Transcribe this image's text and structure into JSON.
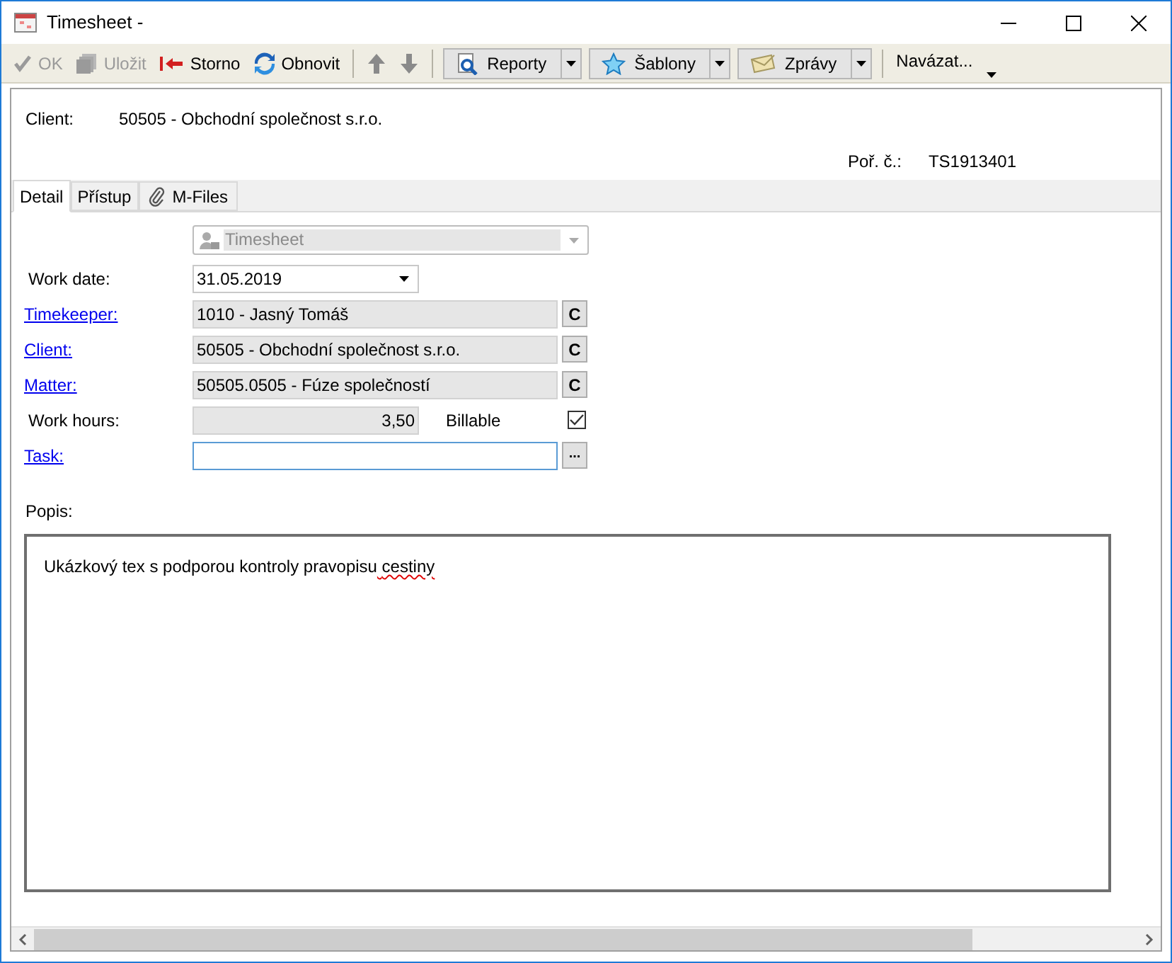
{
  "window": {
    "title": "Timesheet -"
  },
  "toolbar": [
    {
      "kind": "button",
      "label": "OK",
      "disabled": true
    },
    {
      "kind": "button",
      "label": "Uložit",
      "disabled": true
    },
    {
      "kind": "button",
      "label": "Storno",
      "disabled": false
    },
    {
      "kind": "button",
      "label": "Obnovit",
      "disabled": false
    },
    {
      "kind": "separator"
    },
    {
      "kind": "icon"
    },
    {
      "kind": "icon"
    },
    {
      "kind": "separator"
    },
    {
      "kind": "split",
      "label": "Reporty"
    },
    {
      "kind": "split",
      "label": "Šablony"
    },
    {
      "kind": "split",
      "label": "Zprávy"
    },
    {
      "kind": "separator"
    },
    {
      "kind": "menu",
      "label": "Navázat..."
    }
  ],
  "header": {
    "client_label": "Client:",
    "client_value": "50505 - Obchodní společnost s.r.o.",
    "order_label": "Poř. č.:",
    "order_value": "TS1913401"
  },
  "tabs": [
    {
      "label": "Detail",
      "selected": true
    },
    {
      "label": "Přístup",
      "selected": false
    },
    {
      "label": "M-Files",
      "selected": false
    }
  ],
  "type_combo": {
    "value": "Timesheet",
    "disabled": true
  },
  "fields": [
    {
      "kind": "date",
      "label": "Work date:",
      "link": false,
      "value": "31.05.2019"
    },
    {
      "kind": "lookup",
      "label": "Timekeeper:",
      "link": true,
      "value": "1010 - Jasný Tomáš",
      "button": "C"
    },
    {
      "kind": "lookup",
      "label": "Client:",
      "link": true,
      "value": "50505 - Obchodní společnost s.r.o.",
      "button": "C"
    },
    {
      "kind": "lookup",
      "label": "Matter:",
      "link": true,
      "value": "50505.0505 - Fúze společností",
      "button": "C"
    },
    {
      "kind": "number",
      "label": "Work hours:",
      "link": false,
      "value": "3,50",
      "check_label": "Billable",
      "checked": true
    },
    {
      "kind": "text",
      "label": "Task:",
      "link": true,
      "button": "..."
    }
  ],
  "description": {
    "label": "Popis:",
    "segments": [
      {
        "text": "Ukázkový tex s podporou kontroly pravopisu",
        "misspelled": false
      },
      {
        "text": "cestiny",
        "misspelled": true
      }
    ]
  }
}
